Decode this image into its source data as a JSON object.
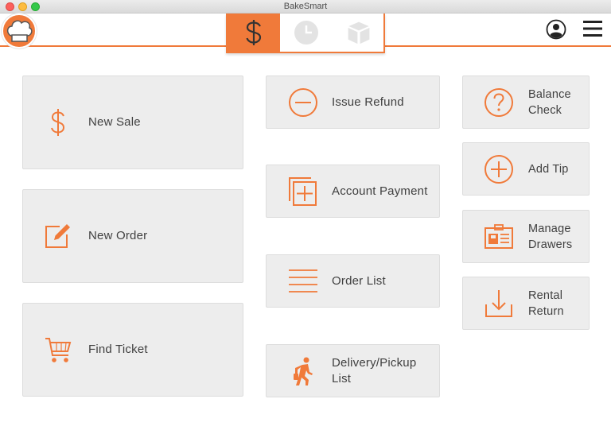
{
  "window": {
    "title": "BakeSmart"
  },
  "header": {
    "logo_icon": "chef-hat-icon",
    "tabs": [
      {
        "name": "sale",
        "icon": "dollar-icon",
        "active": true
      },
      {
        "name": "time",
        "icon": "clock-icon",
        "active": false
      },
      {
        "name": "inventory",
        "icon": "box-icon",
        "active": false
      }
    ],
    "user_icon": "user-icon",
    "menu_icon": "hamburger-menu-icon"
  },
  "tiles": {
    "new_sale": {
      "label": "New Sale",
      "icon": "dollar-icon"
    },
    "new_order": {
      "label": "New Order",
      "icon": "edit-icon"
    },
    "find_ticket": {
      "label": "Find Ticket",
      "icon": "cart-icon"
    },
    "issue_refund": {
      "label": "Issue Refund",
      "icon": "minus-circle-icon"
    },
    "account_payment": {
      "label": "Account Payment",
      "icon": "add-pages-icon"
    },
    "order_list": {
      "label": "Order List",
      "icon": "list-icon"
    },
    "delivery_pickup": {
      "label_line1": "Delivery/Pickup",
      "label_line2": "List",
      "icon": "walking-person-icon"
    },
    "balance_check": {
      "label_line1": "Balance",
      "label_line2": "Check",
      "icon": "question-circle-icon"
    },
    "add_tip": {
      "label": "Add Tip",
      "icon": "plus-circle-icon"
    },
    "manage_drawers": {
      "label_line1": "Manage",
      "label_line2": "Drawers",
      "icon": "id-card-icon"
    },
    "rental_return": {
      "label_line1": "Rental",
      "label_line2": "Return",
      "icon": "download-tray-icon"
    }
  },
  "colors": {
    "accent": "#f07a3a",
    "tile_bg": "#ededed",
    "text": "#404040"
  }
}
